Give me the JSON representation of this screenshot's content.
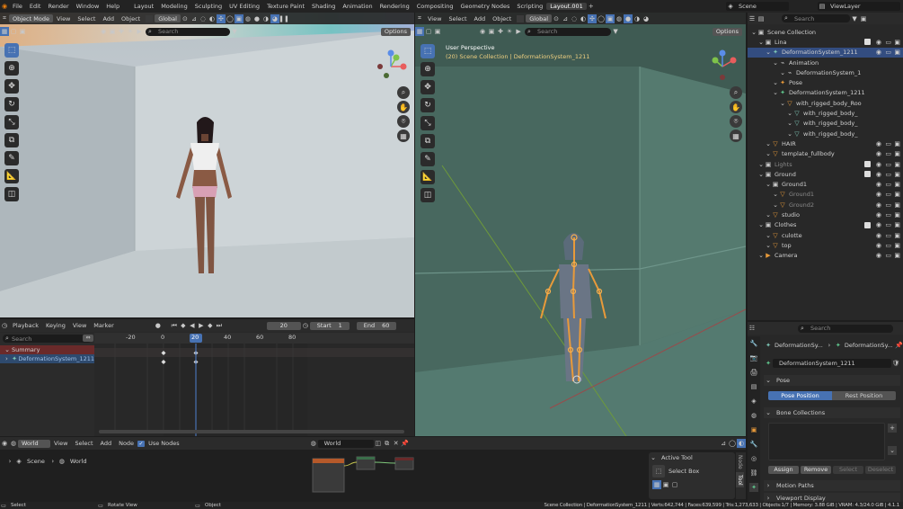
{
  "topbar": {
    "menus": [
      "File",
      "Edit",
      "Render",
      "Window",
      "Help"
    ],
    "workspaces": [
      "Layout",
      "Modeling",
      "Sculpting",
      "UV Editing",
      "Texture Paint",
      "Shading",
      "Animation",
      "Rendering",
      "Compositing",
      "Geometry Nodes",
      "Scripting",
      "Layout.001"
    ],
    "active_workspace": "Layout.001",
    "scene": "Scene",
    "view_layer": "ViewLayer"
  },
  "left_viewport": {
    "mode": "Object Mode",
    "menus": [
      "View",
      "Select",
      "Add",
      "Object"
    ],
    "orientation": "Global",
    "search_placeholder": "Search",
    "options": "Options"
  },
  "right_viewport": {
    "menus": [
      "View",
      "Select",
      "Add",
      "Object"
    ],
    "orientation": "Global",
    "search_placeholder": "Search",
    "options": "Options",
    "overlay_title": "User Perspective",
    "overlay_path": "(20) Scene Collection | DeformationSystem_1211"
  },
  "timeline": {
    "menus": [
      "Playback",
      "Keying",
      "View",
      "Marker"
    ],
    "current_frame": "20",
    "start_label": "Start",
    "start": "1",
    "end_label": "End",
    "end": "60",
    "search_placeholder": "Search",
    "ruler": [
      "-20",
      "0",
      "20",
      "40",
      "60",
      "80"
    ],
    "summary": "Summary",
    "channel": "DeformationSystem_1211"
  },
  "node_editor": {
    "type": "World",
    "menus": [
      "View",
      "Select",
      "Add",
      "Node"
    ],
    "use_nodes": "Use Nodes",
    "world": "World",
    "breadcrumb_scene": "Scene",
    "breadcrumb_world": "World"
  },
  "tool_panel": {
    "title": "Active Tool",
    "tool": "Select Box",
    "tabs": [
      "Node",
      "Tool"
    ]
  },
  "outliner": {
    "search_placeholder": "Search",
    "items": [
      {
        "label": "Scene Collection",
        "indent": 0
      },
      {
        "label": "Lina",
        "indent": 1
      },
      {
        "label": "DeformationSystem_1211",
        "indent": 2
      },
      {
        "label": "Animation",
        "indent": 3
      },
      {
        "label": "DeformationSystem_1",
        "indent": 4
      },
      {
        "label": "Pose",
        "indent": 3
      },
      {
        "label": "DeformationSystem_1211",
        "indent": 3
      },
      {
        "label": "with_rigged_body_Roo",
        "indent": 4
      },
      {
        "label": "with_rigged_body_",
        "indent": 5
      },
      {
        "label": "with_rigged_body_",
        "indent": 5
      },
      {
        "label": "with_rigged_body_",
        "indent": 5
      },
      {
        "label": "HAIR",
        "indent": 2
      },
      {
        "label": "template_fullbody",
        "indent": 2
      },
      {
        "label": "Lights",
        "indent": 1
      },
      {
        "label": "Ground",
        "indent": 1
      },
      {
        "label": "Ground1",
        "indent": 2
      },
      {
        "label": "Ground1",
        "indent": 3
      },
      {
        "label": "Ground2",
        "indent": 3
      },
      {
        "label": "studio",
        "indent": 2
      },
      {
        "label": "Clothes",
        "indent": 1
      },
      {
        "label": "culotte",
        "indent": 2
      },
      {
        "label": "top",
        "indent": 2
      },
      {
        "label": "Camera",
        "indent": 1
      }
    ]
  },
  "properties": {
    "search_placeholder": "Search",
    "breadcrumb_a": "DeformationSy...",
    "breadcrumb_b": "DeformationSy...",
    "armature_name": "DeformationSystem_1211",
    "pose_section": "Pose",
    "pose_position": "Pose Position",
    "rest_position": "Rest Position",
    "bone_collections": "Bone Collections",
    "assign": "Assign",
    "remove": "Remove",
    "select": "Select",
    "deselect": "Deselect",
    "motion_paths": "Motion Paths",
    "viewport_display": "Viewport Display"
  },
  "statusbar": {
    "left": [
      "Select",
      "Rotate View",
      "Object"
    ],
    "right": "Scene Collection | DeformationSystem_1211 | Verts:642,744 | Faces:639,599 | Tris:1,273,633 | Objects:1/7 | Memory: 3.88 GiB | VRAM: 4.3/24.0 GiB | 4.1.1"
  },
  "colors": {
    "accent": "#4772b3",
    "selection_orange": "#e89a3a",
    "viewport_teal": "#4c6e64"
  }
}
